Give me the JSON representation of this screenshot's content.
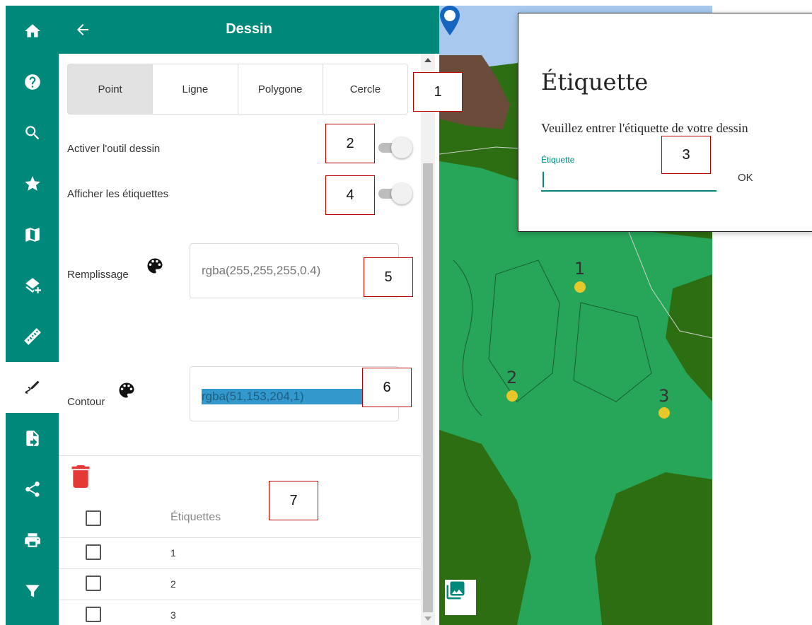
{
  "rail": {
    "icons": [
      "home-icon",
      "help-icon",
      "search-icon",
      "star-icon",
      "map-icon",
      "layers-add-icon",
      "ruler-icon",
      "draw-icon",
      "file-import-icon",
      "share-icon",
      "print-icon",
      "filter-icon"
    ],
    "active": "draw-icon"
  },
  "panel": {
    "title": "Dessin",
    "tabs": [
      "Point",
      "Ligne",
      "Polygone",
      "Cercle"
    ],
    "selected_tab": "Point",
    "activate_label": "Activer l'outil dessin",
    "labels_toggle_label": "Afficher les étiquettes",
    "fill_label": "Remplissage",
    "fill_value": "rgba(255,255,255,0.4)",
    "outline_label": "Contour",
    "outline_value": "rgba(51,153,204,1)",
    "table_header": "Étiquettes",
    "rows": [
      "1",
      "2",
      "3"
    ]
  },
  "map": {
    "points": [
      "1",
      "2",
      "3"
    ],
    "point_color": "#e6c82a"
  },
  "dialog": {
    "title": "Étiquette",
    "message": "Veuillez entrer l'étiquette de votre dessin",
    "field_label": "Étiquette",
    "field_value": "",
    "ok_label": "OK"
  },
  "callouts": [
    "1",
    "2",
    "3",
    "4",
    "5",
    "6",
    "7"
  ],
  "colors": {
    "accent": "#00897b",
    "delete": "#e53935",
    "outline_swatch": "#3399cc"
  }
}
